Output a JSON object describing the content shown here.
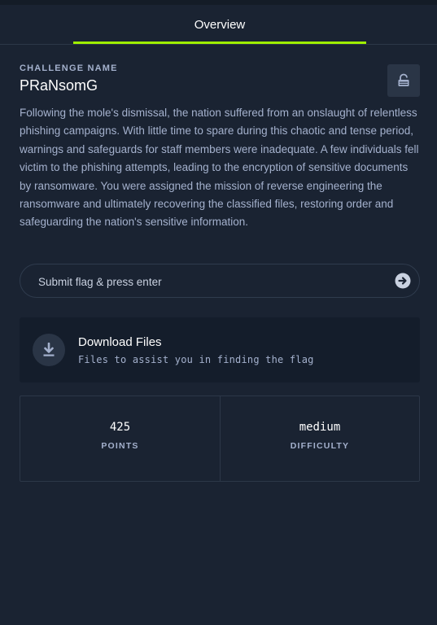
{
  "tabs": {
    "overview": "Overview"
  },
  "challenge": {
    "eyebrow": "CHALLENGE NAME",
    "name": "PRaNsomG",
    "description": "Following the mole's dismissal, the nation suffered from an onslaught of relentless phishing campaigns. With little time to spare during this chaotic and tense period, warnings and safeguards for staff members were inadequate. A few individuals fell victim to the phishing attempts, leading to the encryption of sensitive documents by ransomware. You were assigned the mission of reverse engineering the ransomware and ultimately recovering the classified files, restoring order and safeguarding the nation's sensitive information."
  },
  "flag": {
    "placeholder": "Submit flag & press enter",
    "value": ""
  },
  "download": {
    "title": "Download Files",
    "subtitle": "Files to assist you in finding the flag",
    "icon": "download-icon"
  },
  "stats": {
    "points_value": "425",
    "points_label": "POINTS",
    "difficulty_value": "medium",
    "difficulty_label": "DIFFICULTY"
  },
  "icons": {
    "lock": "lock-open-icon",
    "submit": "arrow-right-circle-icon"
  },
  "colors": {
    "background": "#1a2332",
    "accent": "#9fef00",
    "muted_text": "#a4b1cd",
    "card_background": "#141d2b"
  }
}
